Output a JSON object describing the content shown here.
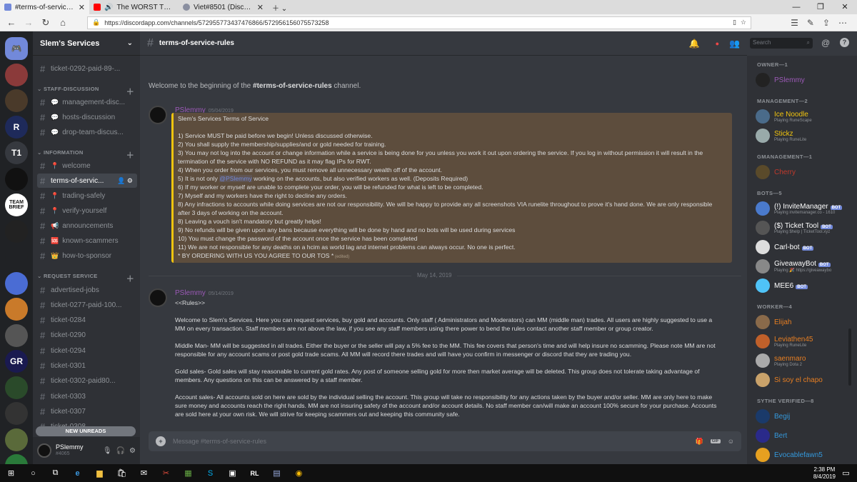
{
  "browser": {
    "tabs": [
      {
        "title": "#terms-of-service-rules",
        "color": "#7289da"
      },
      {
        "title": "The WORST Thing That",
        "color": "#ff0000"
      },
      {
        "title": "Viet#8501 (Discord Tag) Sca",
        "color": "#8a8fa0"
      }
    ],
    "url": "https://discordapp.com/channels/572955773437476866/572956156075573258"
  },
  "guild": {
    "name": "Slem's Services"
  },
  "servers": [
    {
      "label": "",
      "color": "#7289da"
    },
    {
      "label": "",
      "color": "#8b3a3a"
    },
    {
      "label": "",
      "color": "#4a3a2a"
    },
    {
      "label": "R",
      "color": "#1e2a5a"
    },
    {
      "label": "T1",
      "color": "#36393f"
    },
    {
      "label": "",
      "color": "#111"
    },
    {
      "label": "TEAM BRIEF",
      "color": "#fff"
    },
    {
      "label": "",
      "color": "#222"
    },
    {
      "label": "",
      "color": "#202225"
    },
    {
      "label": "",
      "color": "#4a6cd4"
    },
    {
      "label": "",
      "color": "#c97a2a"
    },
    {
      "label": "",
      "color": "#555"
    },
    {
      "label": "GR",
      "color": "#1a1a50"
    },
    {
      "label": "",
      "color": "#2a4a2a"
    },
    {
      "label": "",
      "color": "#333"
    },
    {
      "label": "",
      "color": "#5a6a3a"
    },
    {
      "label": "",
      "color": "#2a7a3a"
    }
  ],
  "channels": {
    "top": {
      "name": "ticket-0292-paid-89-..."
    },
    "staff": {
      "label": "STAFF-DISCUSSION",
      "items": [
        {
          "name": "management-disc...",
          "emoji": "💬"
        },
        {
          "name": "hosts-discussion",
          "emoji": "💬"
        },
        {
          "name": "drop-team-discus...",
          "emoji": "💬"
        }
      ]
    },
    "info": {
      "label": "INFORMATION",
      "items": [
        {
          "name": "welcome",
          "emoji": "📍"
        },
        {
          "name": "terms-of-servic...",
          "emoji": ""
        },
        {
          "name": "trading-safely",
          "emoji": "📍"
        },
        {
          "name": "verify-yourself",
          "emoji": "📍"
        },
        {
          "name": "announcements",
          "emoji": "📢"
        },
        {
          "name": "known-scammers",
          "emoji": "🆘"
        },
        {
          "name": "how-to-sponsor",
          "emoji": "👑"
        }
      ]
    },
    "request": {
      "label": "REQUEST SERVICE",
      "items": [
        {
          "name": "advertised-jobs"
        },
        {
          "name": "ticket-0277-paid-100..."
        },
        {
          "name": "ticket-0284"
        },
        {
          "name": "ticket-0290"
        },
        {
          "name": "ticket-0294"
        },
        {
          "name": "ticket-0301"
        },
        {
          "name": "ticket-0302-paid80..."
        },
        {
          "name": "ticket-0303"
        },
        {
          "name": "ticket-0307"
        },
        {
          "name": "ticket-0308"
        }
      ]
    },
    "new_unreads": "NEW UNREADS"
  },
  "user": {
    "name": "PSlemmy",
    "tag": "#4065"
  },
  "header": {
    "channel": "terms-of-service-rules",
    "search_placeholder": "Search"
  },
  "welcome": {
    "prefix": "Welcome to the beginning of the ",
    "channel": "#terms-of-service-rules",
    "suffix": " channel."
  },
  "message1": {
    "author": "PSlemmy",
    "time": "05/04/2019",
    "lines": [
      "Slem's Services Terms of Service",
      "",
      "1) Service MUST be paid before we begin! Unless discussed otherwise.",
      "2) You shall supply the membership/supplies/and or gold needed for training.",
      "3) You may not log into the account or change information while a service is being done for you unless you work it out upon ordering the service. If you log in without permission it will result in the",
      "termination of the service with NO REFUND as it may flag IPs for RWT.",
      "4) When you order from our services, you must remove all unnecessary wealth off of the account.",
      "5) It is not only @PSlemmy working on the accounts, but also verified workers as well. (Deposits Required)",
      "6) If my worker or myself are unable to complete your order, you will be refunded for what is left to be completed.",
      "7) Myself and my workers have the right to decline any orders.",
      "8) Any infractions to accounts while doing services are not our responsibility. We will be happy to provide any all screenshots VIA runelite throughout to prove it's hand done. We are only responsible",
      "after 3 days of working on the account.",
      "8) Leaving a vouch isn't mandatory but greatly helps!",
      "9) No refunds will be given upon any bans because everything will be done by hand and no bots will be used during services",
      "10) You must change the password of the account once the service has been completed",
      "11) We are not responsible for any deaths on a hcim as world lag and internet problems can always occur. No one is perfect.",
      "* BY ORDERING WITH US YOU AGREE TO OUR TOS *"
    ],
    "edited": "(edited)"
  },
  "divider": "May 14, 2019",
  "message2": {
    "author": "PSlemmy",
    "time": "05/14/2019",
    "lines": [
      "<<Rules>>",
      "",
      "Welcome to Slem's Services. Here you can request services, buy gold and accounts. Only staff ( Administrators and Moderators) can MM (middle man) trades. All users are highly suggested to use a",
      "MM on every transaction. Staff members are not above the law, if you see any staff members using there power to bend the rules contact another staff member or group creator.",
      "",
      "Middle Man- MM will be suggested in all trades. Either the buyer or the seller will pay a 5% fee to the MM. This fee covers that person's time and will help insure no scamming. Please note MM are not",
      "responsible for any account scams or post gold trade scams. All MM will record there trades and will have you confirm in messenger or discord that they are trading you.",
      "",
      "Gold sales- Gold sales will stay reasonable to current gold rates. Any post of someone selling gold for more then market average will be deleted. This group does not tolerate taking advantage of",
      "members. Any questions on this can be answered by a staff member.",
      "",
      "Account sales- All accounts sold on here are sold by the individual selling the account. This group will take no responsibility for any actions taken by the buyer and/or seller. MM are only here to make",
      "sure money and accounts reach the right hands. MM are not insuring safety of the account and/or account details. No staff member can/will make an account 100% secure for your purchase. Accounts",
      "are sold here at your own risk. We will strive for keeping scammers out and keeping this community safe."
    ]
  },
  "composer": {
    "placeholder": "Message #terms-of-service-rules"
  },
  "members": {
    "groups": [
      {
        "label": "OWNER—1",
        "members": [
          {
            "name": "PSlemmy",
            "color": "#9b59b6",
            "sub": "",
            "bot": false
          }
        ]
      },
      {
        "label": "MANAGEMENT—2",
        "members": [
          {
            "name": "Ice Noodle",
            "color": "#f1c40f",
            "sub": "Playing RuneScape",
            "bot": false
          },
          {
            "name": "Stickz",
            "color": "#f1c40f",
            "sub": "Playing RuneLite",
            "bot": false
          }
        ]
      },
      {
        "label": "GMANAGEMENT—1",
        "members": [
          {
            "name": "Cherry",
            "color": "#c0392b",
            "sub": "",
            "bot": false
          }
        ]
      },
      {
        "label": "BOTS—5",
        "members": [
          {
            "name": "(!) InviteManager",
            "color": "#ffffff",
            "sub": "Playing invitemanager.co - 1610",
            "bot": true
          },
          {
            "name": "($) Ticket Tool",
            "color": "#ffffff",
            "sub": "Playing $help | TicketTool.xyz",
            "bot": true
          },
          {
            "name": "Carl-bot",
            "color": "#ffffff",
            "sub": "",
            "bot": true
          },
          {
            "name": "GiveawayBot",
            "color": "#ffffff",
            "sub": "Playing 🎉 https://giveawaybo",
            "bot": true
          },
          {
            "name": "MEE6",
            "color": "#ffffff",
            "sub": "",
            "bot": true
          }
        ]
      },
      {
        "label": "WORKER—4",
        "members": [
          {
            "name": "Elijah",
            "color": "#e67e22",
            "sub": "",
            "bot": false
          },
          {
            "name": "Leviathen45",
            "color": "#e67e22",
            "sub": "Playing RuneLite",
            "bot": false
          },
          {
            "name": "saenmaro",
            "color": "#e67e22",
            "sub": "Playing Dota 2",
            "bot": false
          },
          {
            "name": "Si soy el chapo",
            "color": "#e67e22",
            "sub": "",
            "bot": false
          }
        ]
      },
      {
        "label": "SYTHE VERIFIED—8",
        "members": [
          {
            "name": "Begij",
            "color": "#3498db",
            "sub": "",
            "bot": false
          },
          {
            "name": "Bert",
            "color": "#3498db",
            "sub": "",
            "bot": false
          },
          {
            "name": "Evocablefawn5",
            "color": "#3498db",
            "sub": "",
            "bot": false
          }
        ]
      }
    ],
    "bot_label": "BOT"
  },
  "taskbar": {
    "time": "2:38 PM",
    "date": "8/4/2019"
  }
}
